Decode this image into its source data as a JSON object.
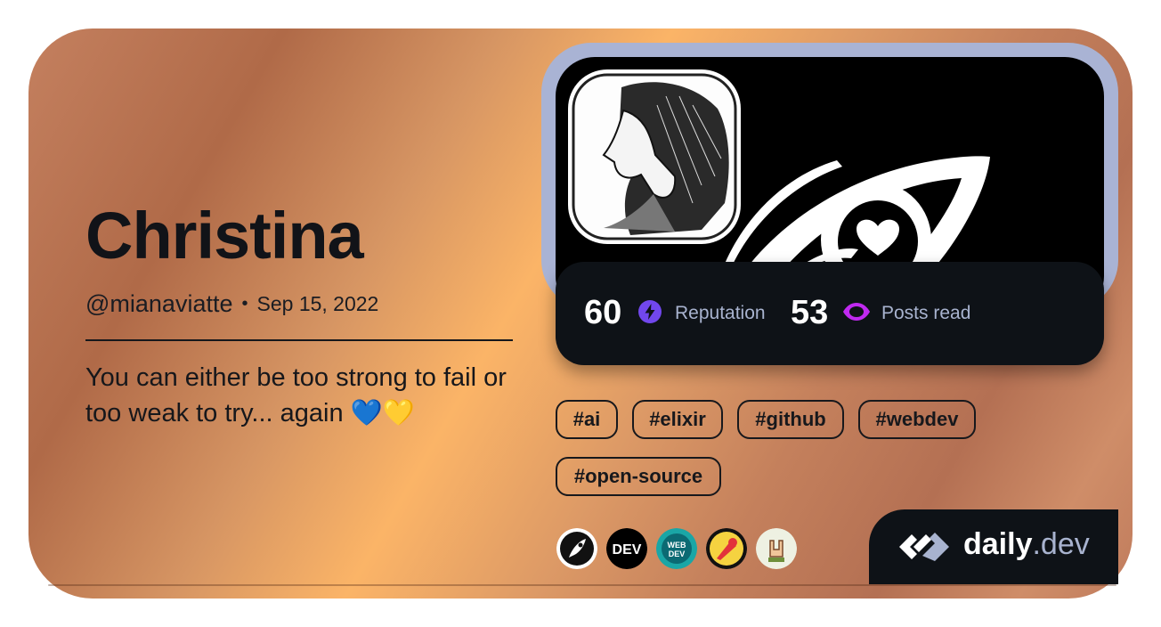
{
  "profile": {
    "name": "Christina",
    "handle": "@mianaviatte",
    "separator": "•",
    "joined": "Sep 15, 2022",
    "bio": "You can either be too strong to fail or too weak to try... again 💙💛"
  },
  "stats": {
    "reputation_value": "60",
    "reputation_label": "Reputation",
    "posts_value": "53",
    "posts_label": "Posts read"
  },
  "tags": [
    "#ai",
    "#elixir",
    "#github",
    "#webdev",
    "#open-source"
  ],
  "badges": [
    "quill-badge",
    "dev-badge",
    "webdev-badge",
    "pen-badge",
    "rock-hand-badge"
  ],
  "brand": {
    "name": "daily",
    "tld": ".dev"
  },
  "colors": {
    "card_accent": "#fbb467",
    "dark_panel": "#0e1217",
    "cover_frame": "#a9b3d4",
    "reputation_icon": "#7147ed",
    "posts_icon": "#c029f0",
    "label": "#a8b3cf"
  }
}
